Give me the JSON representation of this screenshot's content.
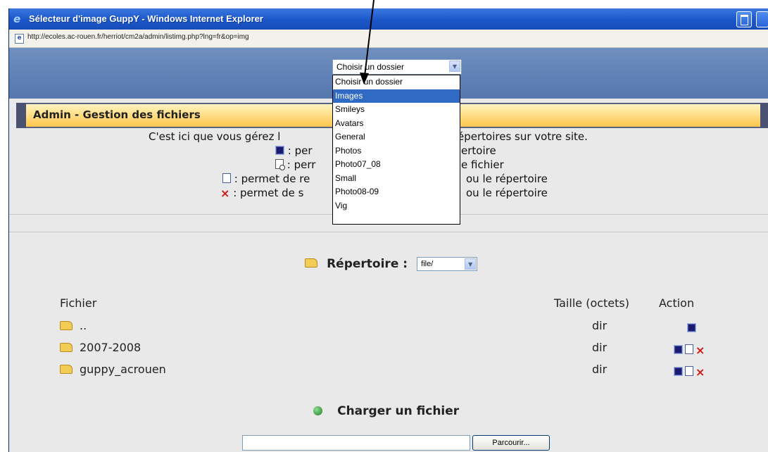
{
  "window": {
    "title": "Sélecteur d'image GuppY - Windows Internet Explorer",
    "url": "http://ecoles.ac-rouen.fr/herriot/cm2a/admin/listimg.php?lng=fr&op=img"
  },
  "folder_select": {
    "value": "Choisir un dossier",
    "options": [
      "Choisir un dossier",
      "Images",
      "Smileys",
      "Avatars",
      "General",
      "Photos",
      "Photo07_08",
      "Small",
      "Photo08-09",
      "Vig"
    ],
    "highlighted": "Images"
  },
  "panel": {
    "heading": "Admin - Gestion des fichiers"
  },
  "intro": {
    "line1_left": "C'est ici que vous gérez l",
    "line1_right": "épertoires sur votre site.",
    "line2_left": ": per",
    "line2_right": "ertoire",
    "line3_left": ": perr",
    "line3_right": "e fichier",
    "line4_left": ": permet de re",
    "line4_right": "ou le répertoire",
    "line5_left": ": permet de s",
    "line5_right": "ou le répertoire"
  },
  "repertoire": {
    "label": "Répertoire :",
    "value": "file/"
  },
  "table": {
    "headers": {
      "file": "Fichier",
      "size": "Taille (octets)",
      "action": "Action"
    },
    "rows": [
      {
        "name": "..",
        "size": "dir"
      },
      {
        "name": "2007-2008",
        "size": "dir"
      },
      {
        "name": "guppy_acrouen",
        "size": "dir"
      }
    ]
  },
  "upload": {
    "label": "Charger un fichier",
    "browse_label": "Parcourir..."
  },
  "colors": {
    "title_bar": "#1b56c8",
    "top_band": "#6f8fc0",
    "panel_header": "#ffc64d",
    "selection": "#316ac5",
    "delete": "#d01515"
  }
}
